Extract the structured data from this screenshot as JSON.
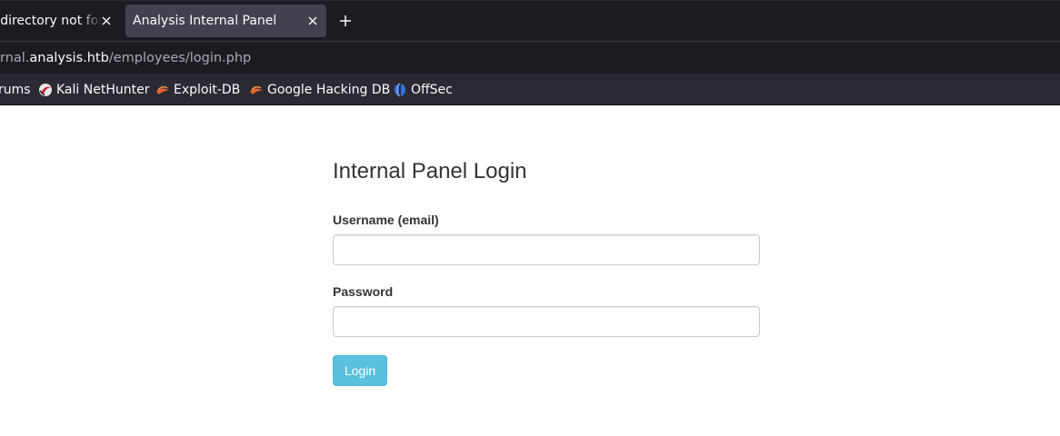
{
  "browser": {
    "tabs": [
      {
        "title": "r directory not fou",
        "active": false
      },
      {
        "title": "Analysis Internal Panel",
        "active": true
      }
    ],
    "url": {
      "prefix": "rnal.",
      "host": "analysis.htb",
      "path": "/employees/login.php"
    },
    "bookmarks": [
      {
        "label": "rums",
        "icon": "forum-icon"
      },
      {
        "label": "Kali NetHunter",
        "icon": "kali-nethunter-icon"
      },
      {
        "label": "Exploit-DB",
        "icon": "exploit-db-icon"
      },
      {
        "label": "Google Hacking DB",
        "icon": "google-hacking-db-icon"
      },
      {
        "label": "OffSec",
        "icon": "offsec-icon"
      }
    ],
    "colors": {
      "tabbar_bg": "#1c1b22",
      "active_tab_bg": "#42414d",
      "toolbar_bg": "#2b2a33"
    }
  },
  "page": {
    "title": "Internal Panel Login",
    "username_label": "Username (email)",
    "username_value": "",
    "password_label": "Password",
    "password_value": "",
    "login_label": "Login",
    "colors": {
      "button_bg": "#5bc0de",
      "text": "#333333"
    }
  }
}
